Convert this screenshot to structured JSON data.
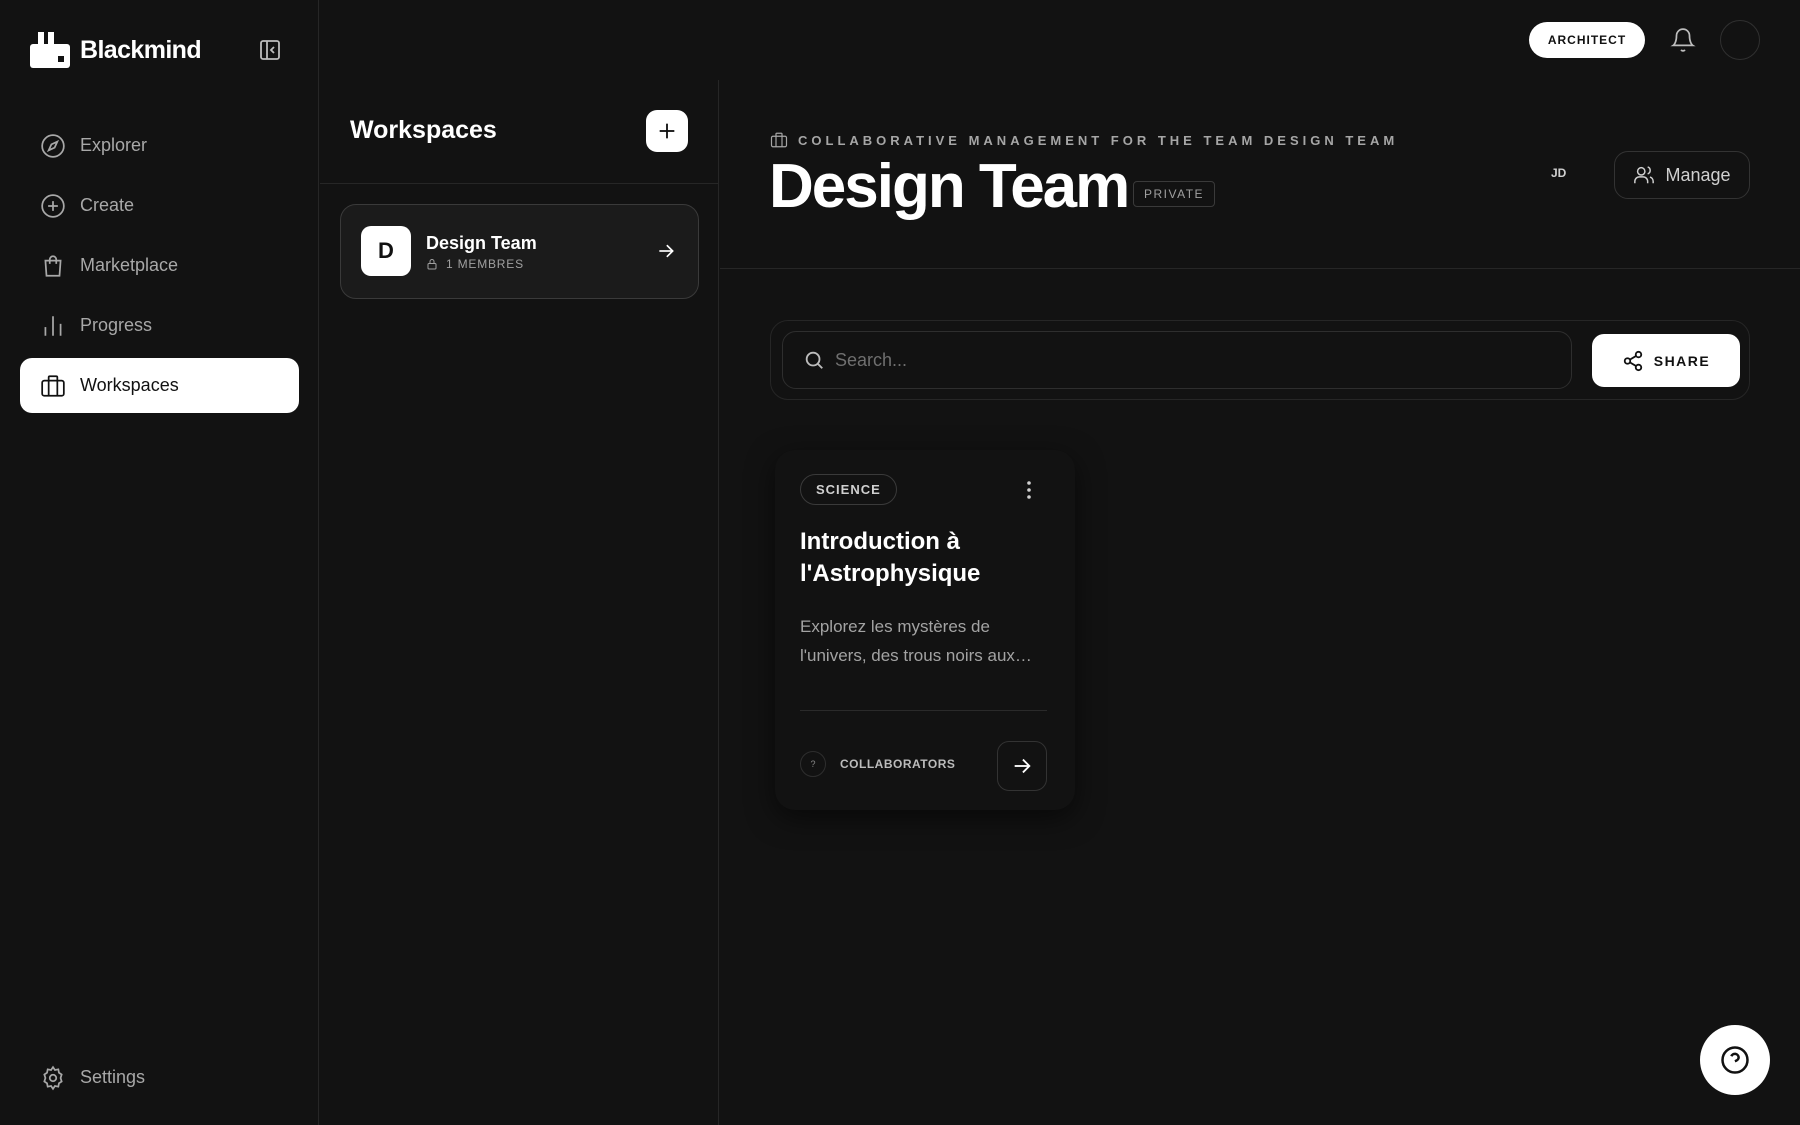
{
  "brand": {
    "name": "Blackmind",
    "logo_icon": "factory-icon"
  },
  "sidebar": {
    "items": [
      {
        "label": "Explorer",
        "icon": "compass-icon",
        "active": false
      },
      {
        "label": "Create",
        "icon": "plus-circle-icon",
        "active": false
      },
      {
        "label": "Marketplace",
        "icon": "shopping-bag-icon",
        "active": false
      },
      {
        "label": "Progress",
        "icon": "bar-chart-icon",
        "active": false
      },
      {
        "label": "Workspaces",
        "icon": "briefcase-icon",
        "active": true
      }
    ],
    "settings_label": "Settings"
  },
  "topbar": {
    "role_badge": "ARCHITECT"
  },
  "workspaces_panel": {
    "title": "Workspaces",
    "items": [
      {
        "initial": "D",
        "name": "Design Team",
        "members": "1 MEMBRES"
      }
    ]
  },
  "workspace": {
    "subtitle": "COLLABORATIVE MANAGEMENT FOR THE TEAM DESIGN TEAM",
    "title": "Design Team",
    "visibility": "PRIVATE",
    "member_initials": "JD",
    "manage_label": "Manage"
  },
  "search": {
    "placeholder": "Search...",
    "value": ""
  },
  "share_label": "SHARE",
  "courses": [
    {
      "tag": "SCIENCE",
      "title": "Introduction à l'Astrophysique",
      "description": "Explorez les mystères de l'univers, des trous noirs aux…",
      "collaborators_initial": "?",
      "collaborators_label": "COLLABORATORS"
    }
  ],
  "colors": {
    "background": "#121212",
    "surface": "#1b1b1b",
    "accent": "#ffffff",
    "muted_text": "#a8a8a8"
  }
}
